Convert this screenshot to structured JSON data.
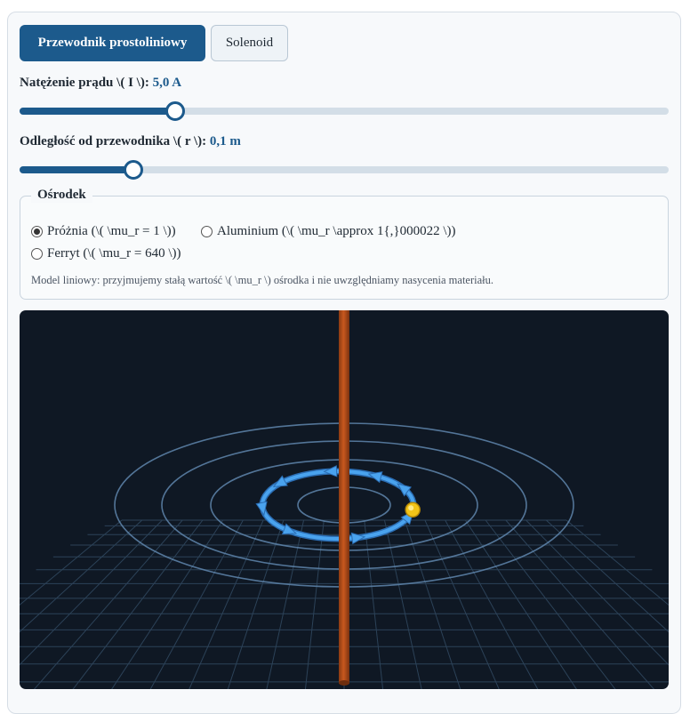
{
  "tabs": [
    {
      "label": "Przewodnik prostoliniowy",
      "active": true
    },
    {
      "label": "Solenoid",
      "active": false
    }
  ],
  "current": {
    "label": "Natężenie prądu \\( I \\):",
    "value_text": "5,0 A",
    "fraction": 0.24
  },
  "distance": {
    "label": "Odległość od przewodnika \\( r \\):",
    "value_text": "0,1 m",
    "fraction": 0.176
  },
  "medium": {
    "legend": "Ośrodek",
    "options": [
      {
        "label": "Próżnia (\\( \\mu_r = 1 \\))",
        "checked": true
      },
      {
        "label": "Aluminium (\\( \\mu_r \\approx 1{,}000022 \\))",
        "checked": false
      },
      {
        "label": "Ferryt (\\( \\mu_r = 640 \\))",
        "checked": false
      }
    ],
    "note": "Model liniowy: przyjmujemy stałą wartość \\( \\mu_r \\) ośrodka i nie uwzględniamy nasycenia materiału."
  },
  "colors": {
    "accent": "#1c5a8c",
    "scene_background": "#0f1824",
    "wire": "#c8581e",
    "field_loop": "#4aa3ee",
    "field_rings": "#5f86ad",
    "grid": "#2c4258",
    "probe": "#f2c418"
  },
  "icons": {
    "wire": "conductor-icon",
    "probe": "probe-point-icon"
  }
}
